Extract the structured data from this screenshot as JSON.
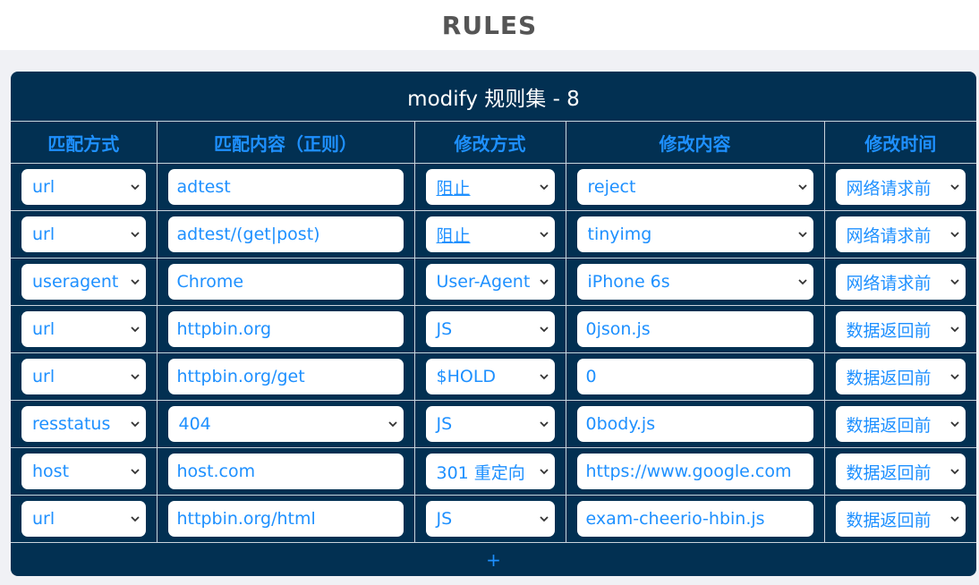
{
  "page_title": "RULES",
  "panel_title": "modify 规则集 - 8",
  "headers": [
    "匹配方式",
    "匹配内容（正则）",
    "修改方式",
    "修改内容",
    "修改时间"
  ],
  "rows": [
    {
      "match_type": "url",
      "match_content": "adtest",
      "modify_type": "阻止",
      "modify_content": "reject",
      "modify_time": "网络请求前"
    },
    {
      "match_type": "url",
      "match_content": "adtest/(get|post)",
      "modify_type": "阻止",
      "modify_content": "tinyimg",
      "modify_time": "网络请求前"
    },
    {
      "match_type": "useragent",
      "match_content": "Chrome",
      "modify_type": "User-Agent",
      "modify_content": "iPhone 6s",
      "modify_time": "网络请求前"
    },
    {
      "match_type": "url",
      "match_content": "httpbin.org",
      "modify_type": "JS",
      "modify_content": "0json.js",
      "modify_time": "数据返回前"
    },
    {
      "match_type": "url",
      "match_content": "httpbin.org/get",
      "modify_type": "$HOLD",
      "modify_content": "0",
      "modify_time": "数据返回前"
    },
    {
      "match_type": "resstatus",
      "match_content": "404",
      "modify_type": "JS",
      "modify_content": "0body.js",
      "modify_time": "数据返回前"
    },
    {
      "match_type": "host",
      "match_content": "host.com",
      "modify_type": "301 重定向",
      "modify_content": "https://www.google.com",
      "modify_time": "数据返回前"
    },
    {
      "match_type": "url",
      "match_content": "httpbin.org/html",
      "modify_type": "JS",
      "modify_content": "exam-cheerio-hbin.js",
      "modify_time": "数据返回前"
    }
  ],
  "add_label": "+",
  "colors": {
    "panel": "#023052",
    "accent": "#1e90ff",
    "border": "#c9d3dc"
  },
  "icons": {
    "dropdown": "chevron-down-icon"
  }
}
